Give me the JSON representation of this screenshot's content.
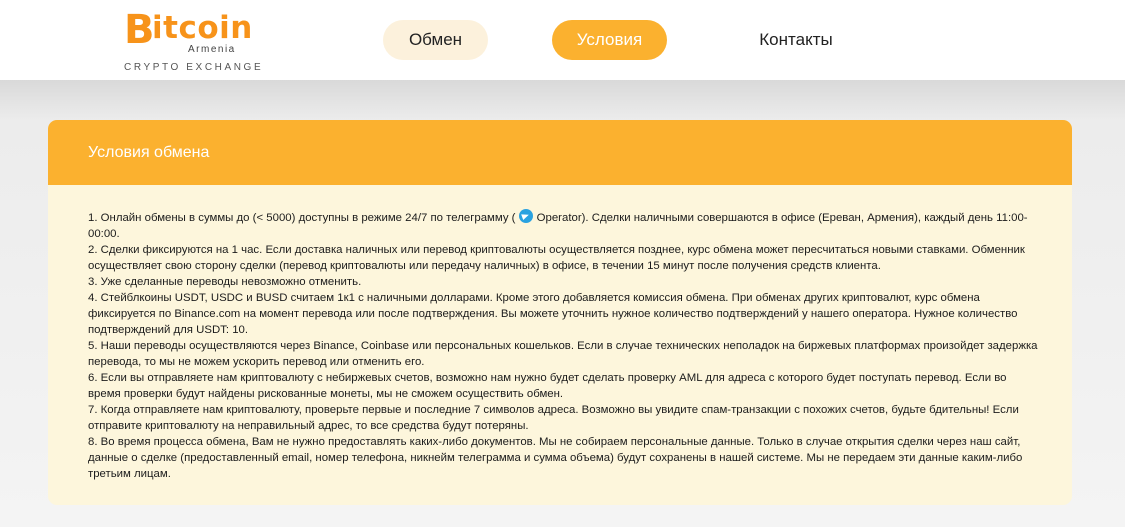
{
  "logo": {
    "initial": "B",
    "word": "itcoin",
    "subtitle": "Armenia",
    "tagline": "CRYPTO EXCHANGE"
  },
  "nav": {
    "exchange": "Обмен",
    "terms": "Условия",
    "contacts": "Контакты"
  },
  "terms": {
    "title": "Условия обмена",
    "item1_before": "1. Онлайн обмены в суммы до (< 5000) доступны в режиме 24/7 по телеграмму (",
    "item1_link": "Operator",
    "item1_after": "). Сделки наличными совершаются в офисе (Ереван, Армения), каждый день 11:00-00:00.",
    "item2": "2. Сделки фиксируются на 1 час. Если доставка наличных или перевод криптовалюты осуществляется позднее, курс обмена может пересчитаться новыми ставками. Обменник осуществляет свою сторону сделки (перевод криптовалюты или передачу наличных) в офисе, в течении 15 минут после получения средств клиента.",
    "item3": "3. Уже сделанные переводы невозможно отменить.",
    "item4": "4. Стейблкоины USDT, USDC и BUSD считаем 1к1 с наличными долларами. Кроме этого добавляется комиссия обмена. При обменах других криптовалют, курс обмена фиксируется по Binance.com на момент перевода или после подтверждения. Вы можете уточнить нужное количество подтверждений у нашего оператора. Нужное количество подтверждений для USDT: 10.",
    "item5": "5. Наши переводы осуществляются через Binance, Coinbase или персональных кошельков. Если в случае технических неполадок на биржевых платформах произойдет задержка перевода, то мы не можем ускорить перевод или отменить его.",
    "item6": "6. Если вы отправляете нам криптовалюту с небиржевых счетов, возможно нам нужно будет сделать проверку AML для адреса с которого будет поступать перевод. Если во время проверки будут найдены рискованные монеты, мы не сможем осуществить обмен.",
    "item7": "7. Когда отправляете нам криптовалюту, проверьте первые и последние 7 символов адреса. Возможно вы увидите спам-транзакции с похожих счетов, будьте бдительны! Если отправите криптовалюту на неправильный адрес, то все средства будут потеряны.",
    "item8": "8. Во время процесса обмена, Вам не нужно предоставлять каких-либо документов. Мы не собираем персональные данные. Только в случае открытия сделки через наш сайт, данные о сделке (предоставленный email, номер телефона, никнейм телеграмма и сумма объема) будут сохранены в нашей системе. Мы не передаем эти данные каким-либо третьим лицам."
  },
  "colors": {
    "accent": "#fbb12f",
    "logo": "#f7931a",
    "card_background": "#fdf6dc",
    "telegram": "#2aa2e0"
  },
  "icons": {
    "telegram": "telegram-icon"
  }
}
